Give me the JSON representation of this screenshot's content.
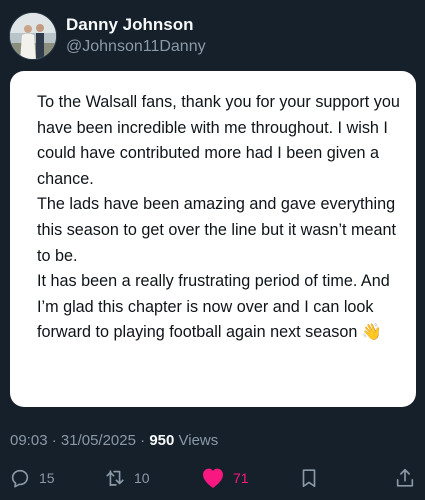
{
  "author": {
    "display_name": "Danny Johnson",
    "handle": "@Johnson11Danny",
    "avatar_icon": "profile-photo"
  },
  "tweet": {
    "text": "To the Walsall fans, thank you for your support you have been incredible with me throughout. I wish I could have contributed more had I been given a chance.\nThe lads have been amazing and gave everything this season to get over the line but it wasn’t meant to be.\nIt has been a really frustrating period of time. And I’m glad this chapter is now over and I can look forward to playing football again next season 👋"
  },
  "meta": {
    "time": "09:03",
    "separator": "·",
    "date": "31/05/2025",
    "views_count": "950",
    "views_label": "Views"
  },
  "actions": {
    "replies": "15",
    "reposts": "10",
    "likes": "71",
    "reply_icon": "reply-icon",
    "repost_icon": "repost-icon",
    "like_icon": "heart-icon",
    "bookmark_icon": "bookmark-icon",
    "share_icon": "share-icon"
  },
  "colors": {
    "background": "#15202b",
    "like_active": "#f91880",
    "muted": "#8b98a5"
  }
}
